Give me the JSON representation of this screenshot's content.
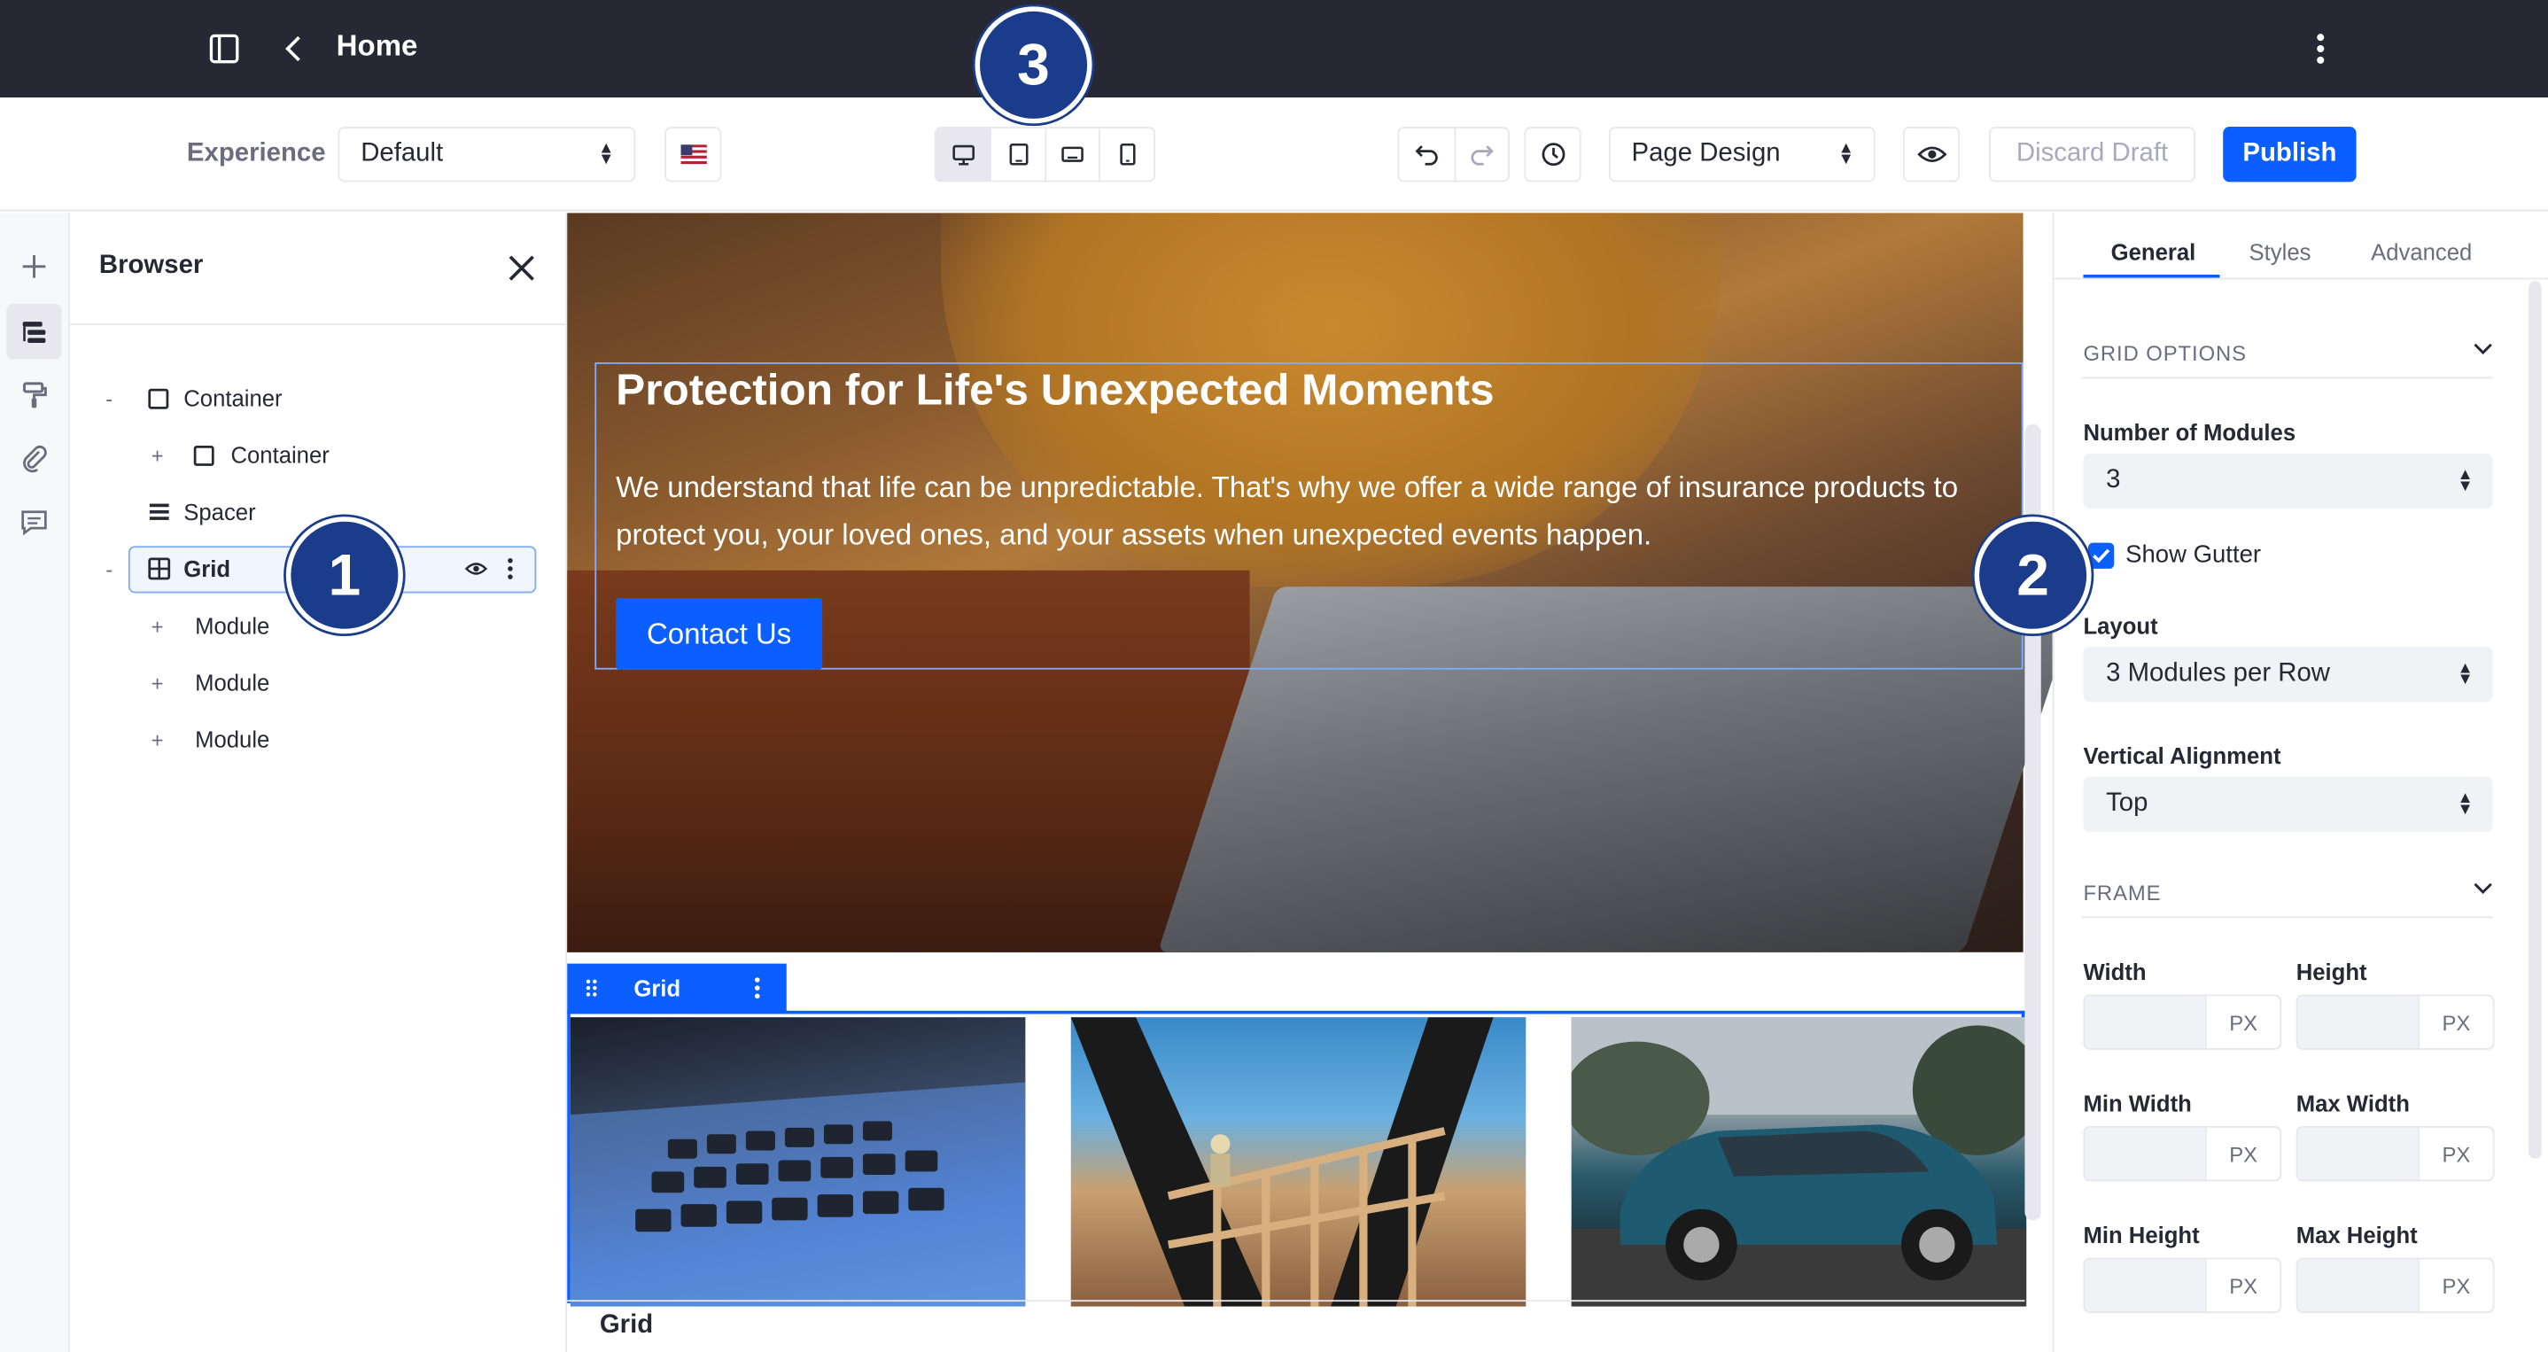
{
  "header": {
    "title": "Home",
    "panel_icon": "sidebar-icon",
    "back_icon": "chevron-left-icon",
    "menu_icon": "kebab-icon"
  },
  "toolbar": {
    "experience_label": "Experience",
    "experience_value": "Default",
    "language_icon": "us-flag-icon",
    "viewports": [
      "desktop-icon",
      "tablet-icon",
      "landscape-phone-icon",
      "portrait-phone-icon"
    ],
    "mode_value": "Page Design",
    "discard_label": "Discard Draft",
    "publish_label": "Publish"
  },
  "browser": {
    "title": "Browser",
    "items": [
      {
        "toggle": "-",
        "label": "Container",
        "icon": "container-icon"
      },
      {
        "toggle": "+",
        "label": "Container",
        "icon": "container-icon"
      },
      {
        "toggle": "",
        "label": "Spacer",
        "icon": "spacer-icon"
      },
      {
        "toggle": "-",
        "label": "Grid",
        "icon": "grid-icon"
      },
      {
        "toggle": "+",
        "label": "Module"
      },
      {
        "toggle": "+",
        "label": "Module"
      },
      {
        "toggle": "+",
        "label": "Module"
      }
    ]
  },
  "hero": {
    "title": "Protection for Life's Unexpected Moments",
    "text": "We understand that life can be unpredictable. That's why we offer a wide range of insurance products to protect you, your loved ones, and your assets when unexpected events happen.",
    "button_label": "Contact Us"
  },
  "grid": {
    "tag_label": "Grid",
    "bottom_label": "Grid"
  },
  "panel": {
    "tabs": [
      "General",
      "Styles",
      "Advanced"
    ],
    "grid_options_title": "GRID OPTIONS",
    "modules_label": "Number of Modules",
    "modules_value": "3",
    "gutter_label": "Show Gutter",
    "layout_label": "Layout",
    "layout_value": "3 Modules per Row",
    "valign_label": "Vertical Alignment",
    "valign_value": "Top",
    "frame_title": "FRAME",
    "width_label": "Width",
    "height_label": "Height",
    "min_width_label": "Min Width",
    "max_width_label": "Max Width",
    "min_height_label": "Min Height",
    "max_height_label": "Max Height",
    "unit": "PX"
  },
  "callouts": [
    "1",
    "2",
    "3"
  ],
  "colors": {
    "accent": "#0b5fff",
    "topbar": "#272833",
    "callout": "#1a3c8a"
  }
}
